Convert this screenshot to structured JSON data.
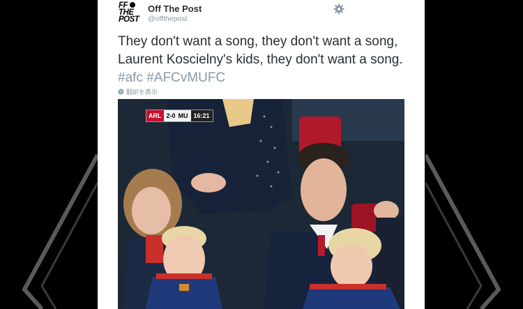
{
  "tweet": {
    "account_name": "Off The Post",
    "account_handle": "@offthepost",
    "avatar_lines": [
      "FF",
      "THE",
      "POST"
    ],
    "text_parts": [
      "They don't want a song, they don't want a song, Laurent Koscielny's kids, they don't want a song. "
    ],
    "hashtags": [
      "#afc",
      "#AFCvMUFC"
    ],
    "translate_label": "翻訳を表示",
    "icons": {
      "settings": "gear-icon",
      "translate": "globe-icon"
    }
  },
  "photo_overlay": {
    "home_team": "ARL",
    "score": "2-0",
    "away_team": "MU",
    "clock": "16:21"
  },
  "colors": {
    "background": "#000000",
    "card": "#ffffff",
    "text": "#292f33",
    "muted": "#8899a6",
    "deco_line": "#5a5a5a"
  }
}
